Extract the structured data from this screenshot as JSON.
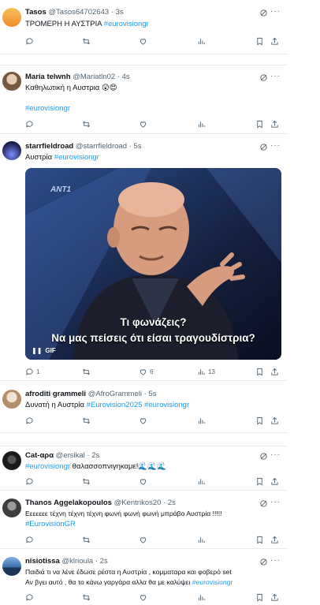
{
  "tweets": [
    {
      "name": "Tasos",
      "handle": "@Tasos64702643",
      "time": "3s",
      "text_plain": "ΤΡΟΜΕΡΗ Η ΑΥΣΤΡΙΑ ",
      "text_hashtag": "#eurovisiongr",
      "avatar_color": "#f4a340"
    },
    {
      "name": "Maria telwnh",
      "handle": "@Mariatln02",
      "time": "4s",
      "text_plain": "Καθηλωτική η Αυστρια 😲😍",
      "text_hashtag": "#eurovisiongr",
      "avatar_color": "#c9a98a"
    },
    {
      "name": "starrfieldroad",
      "handle": "@starrfieldroad",
      "time": "5s",
      "text_plain": "Αυστρία ",
      "text_hashtag": "#eurovisiongr",
      "avatar_color": "#3b3f8a",
      "media": {
        "caption_line1": "Τι φωνάζεις?",
        "caption_line2": "Να μας πείσεις ότι είσαι τραγουδίστρια?",
        "badge": "GIF",
        "brand": "ANT1"
      },
      "counts": {
        "replies": "1",
        "likes": "6",
        "views": "13"
      }
    },
    {
      "name": "afroditi grammeli",
      "handle": "@AfroGrammeli",
      "time": "5s",
      "text_plain": "Δυνατή η Αυστρία ",
      "text_hashtag": "#Eurovision2025",
      "text_hashtag2": "#eurovisiongr",
      "avatar_color": "#d8c6b4"
    },
    {
      "name": "Cat-αρα",
      "handle": "@ersikal",
      "time": "2s",
      "text_hashtag": "#eurovisiongr",
      "text_plain": " θαλασσοπνιγηκαμε!🌊🌊🌊",
      "avatar_color": "#2a2a2a"
    },
    {
      "name": "Thanos Aggelakopoulos",
      "handle": "@Kentrikos20",
      "time": "2s",
      "text_plain": "Εεεεεεε τέχνη τέχνη τέχνη φωνή φωνή φωνή μπράβο Αυστρία !!!!!",
      "text_hashtag": "#EurovisionGR",
      "avatar_color": "#6b6b6b"
    },
    {
      "name": "nisiotissa",
      "handle": "@klrioula",
      "time": "2s",
      "text_plain": "Παιδιά τι να λένε έδωσε ρέστα η Αυστρία , κομματαρα και φοβερό set",
      "text_plain2": "Αν βγει αυτό , θα το κάνω γαργάρα αλλα θα με καλύψει ",
      "text_hashtag": "#eurovisiongr",
      "avatar_color": "#3f6fa8"
    }
  ],
  "colors": {
    "hashtag": "#1d9bf0",
    "muted": "#536471"
  },
  "icons": [
    "reply-icon",
    "retweet-icon",
    "like-icon",
    "views-icon",
    "bookmark-icon",
    "share-icon",
    "grok-icon",
    "more-icon"
  ]
}
